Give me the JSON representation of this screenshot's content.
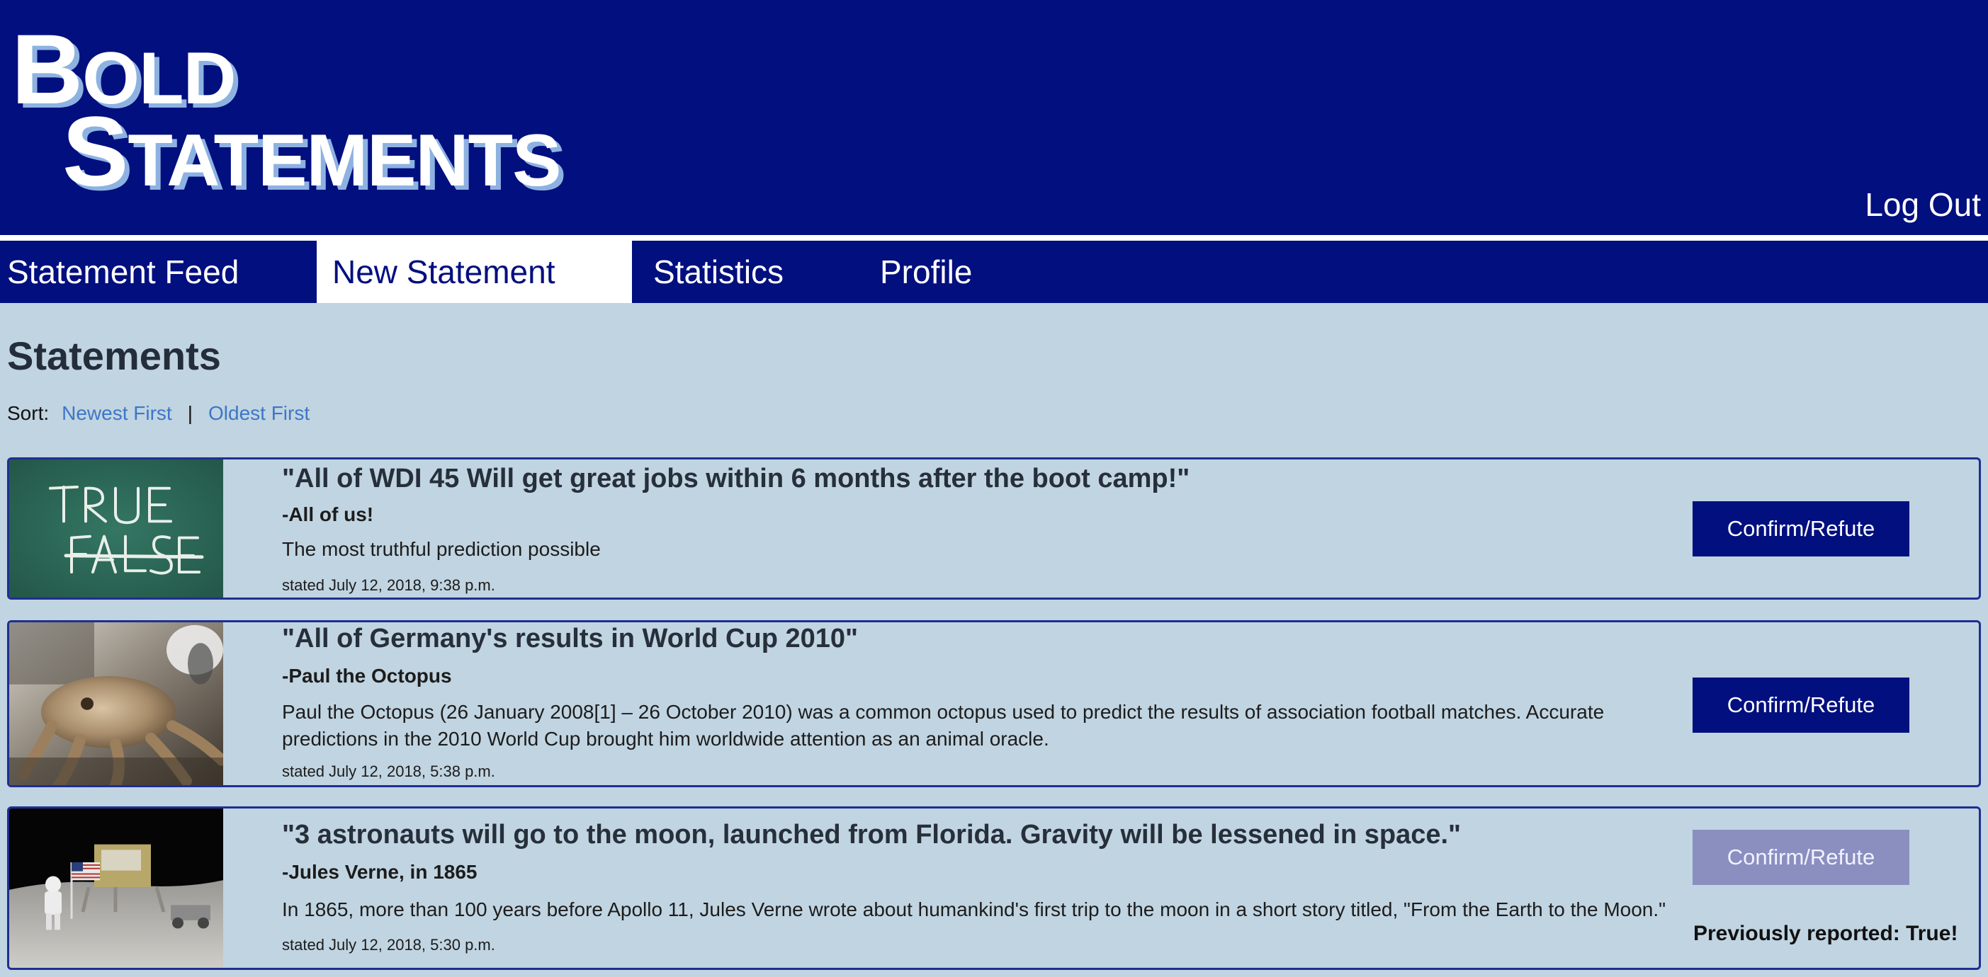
{
  "header": {
    "logo_first_line": {
      "big": "B",
      "small": "OLD"
    },
    "logo_second_line": {
      "big": "S",
      "small": "TATEMENTS"
    },
    "logout_label": "Log Out"
  },
  "nav": {
    "tabs": [
      {
        "label": "Statement Feed",
        "active": false
      },
      {
        "label": "New Statement",
        "active": true
      },
      {
        "label": "Statistics",
        "active": false
      },
      {
        "label": "Profile",
        "active": false
      }
    ]
  },
  "main": {
    "title": "Statements",
    "sort": {
      "label": "Sort:",
      "options": [
        "Newest First",
        "Oldest First"
      ],
      "separator": "|"
    },
    "statements": [
      {
        "quote": "\"All of WDI 45 Will get great jobs within 6 months after the boot camp!\"",
        "author": "-All of us!",
        "description": "The most truthful prediction possible",
        "stated": "stated July 12, 2018, 9:38 p.m.",
        "button_label": "Confirm/Refute",
        "button_enabled": true,
        "image": "chalkboard-true-false"
      },
      {
        "quote": "\"All of Germany's results in World Cup 2010\"",
        "author": "-Paul the Octopus",
        "description": "Paul the Octopus (26 January 2008[1] – 26 October 2010) was a common octopus used to predict the results of association football matches. Accurate predictions in the 2010 World Cup brought him worldwide attention as an animal oracle.",
        "stated": "stated July 12, 2018, 5:38 p.m.",
        "button_label": "Confirm/Refute",
        "button_enabled": true,
        "image": "octopus-photo"
      },
      {
        "quote": "\"3 astronauts will go to the moon, launched from Florida. Gravity will be lessened in space.\"",
        "author": "-Jules Verne, in 1865",
        "description": "In 1865, more than 100 years before Apollo 11, Jules Verne wrote about humankind's first trip to the moon in a short story titled, \"From the Earth to the Moon.\"",
        "stated": "stated July 12, 2018, 5:30 p.m.",
        "button_label": "Confirm/Refute",
        "button_enabled": false,
        "previous_report": "Previously reported: True!",
        "image": "astronaut-moon-photo"
      }
    ]
  },
  "colors": {
    "header_bg": "#020f7e",
    "page_bg": "#c1d4e1",
    "link": "#3d77c7",
    "button": "#020f7e",
    "button_disabled": "#8a8fc0",
    "card_border": "#1e2f91"
  }
}
